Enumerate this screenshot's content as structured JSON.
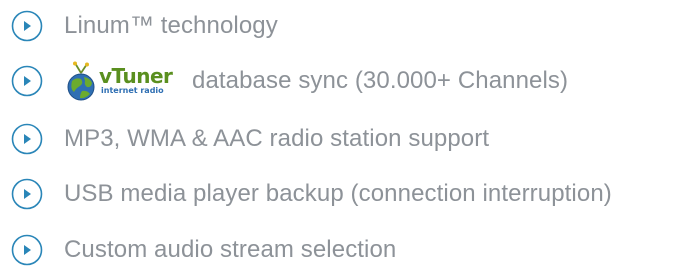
{
  "features": [
    {
      "text": "Linum™ technology",
      "icon": "play-circle-icon"
    },
    {
      "text": "database sync (30.000+ Channels)",
      "icon": "play-circle-icon",
      "logo": {
        "name": "vtuner-logo",
        "wordmark": "vTuner",
        "subtitle": "internet radio"
      }
    },
    {
      "text": "MP3, WMA & AAC radio station support",
      "icon": "play-circle-icon"
    },
    {
      "text": "USB media player backup (connection interruption)",
      "icon": "play-circle-icon"
    },
    {
      "text": "Custom audio stream selection",
      "icon": "play-circle-icon"
    }
  ],
  "colors": {
    "icon_stroke": "#2a86b8",
    "text": "#8d9298",
    "vtuner_green": "#5a8f1f",
    "vtuner_blue": "#2f6fb3"
  }
}
